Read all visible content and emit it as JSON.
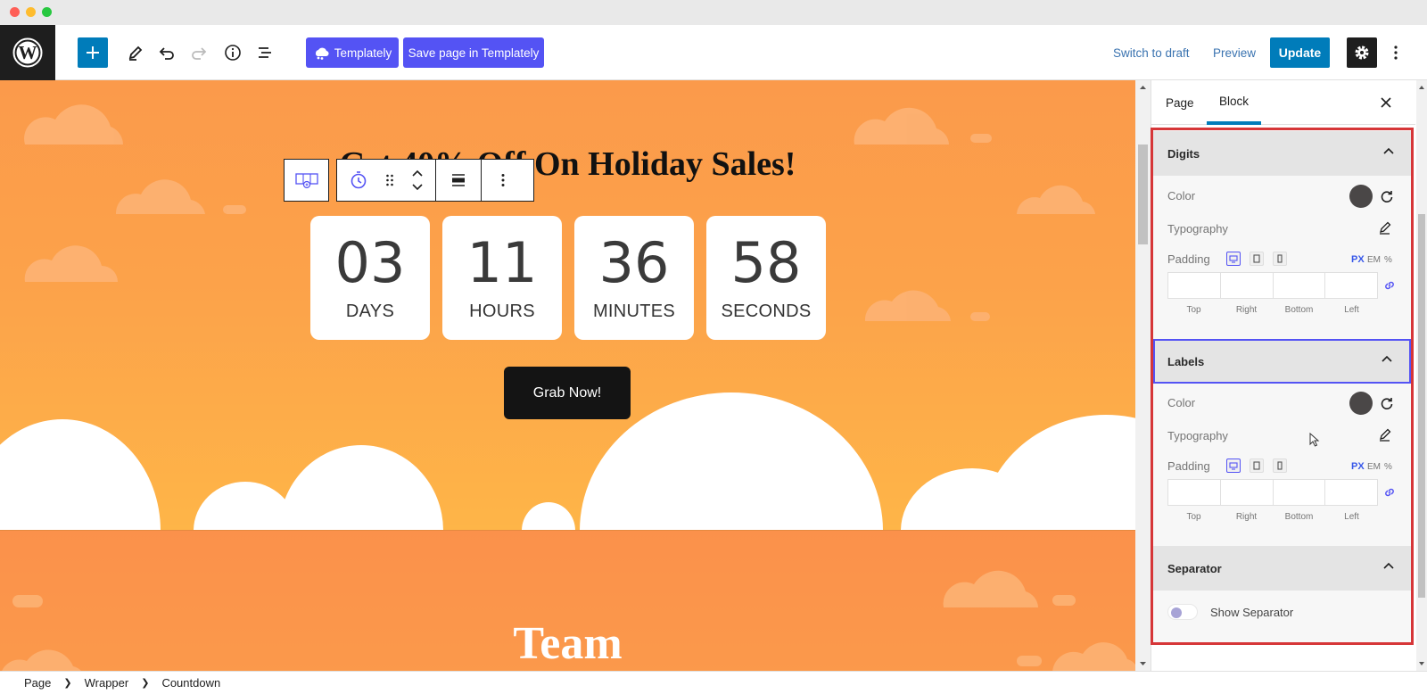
{
  "toolbar": {
    "templately_label": "Templately",
    "save_templately_label": "Save page in Templately",
    "switch_draft_label": "Switch to draft",
    "preview_label": "Preview",
    "update_label": "Update"
  },
  "canvas": {
    "heading": "Get 40% Off On Holiday Sales!",
    "countdown": [
      {
        "value": "03",
        "label": "DAYS"
      },
      {
        "value": "11",
        "label": "HOURS"
      },
      {
        "value": "36",
        "label": "MINUTES"
      },
      {
        "value": "58",
        "label": "SECONDS"
      }
    ],
    "button_label": "Grab Now!",
    "team_heading": "Team"
  },
  "sidebar": {
    "tabs": [
      {
        "label": "Page"
      },
      {
        "label": "Block"
      }
    ],
    "active_tab": "Block",
    "digits": {
      "title": "Digits",
      "color_label": "Color",
      "color_value": "#4a4747",
      "typography_label": "Typography",
      "padding_label": "Padding",
      "units": [
        "PX",
        "EM",
        "%"
      ],
      "pad_labels": [
        "Top",
        "Right",
        "Bottom",
        "Left"
      ]
    },
    "labels": {
      "title": "Labels",
      "color_label": "Color",
      "color_value": "#4a4747",
      "typography_label": "Typography",
      "padding_label": "Padding",
      "units": [
        "PX",
        "EM",
        "%"
      ],
      "pad_labels": [
        "Top",
        "Right",
        "Bottom",
        "Left"
      ]
    },
    "separator": {
      "title": "Separator",
      "toggle_label": "Show Separator"
    }
  },
  "breadcrumb": [
    "Page",
    "Wrapper",
    "Countdown"
  ],
  "colors": {
    "accent": "#007cba",
    "templately": "#5453f4",
    "highlight": "#d63638"
  }
}
